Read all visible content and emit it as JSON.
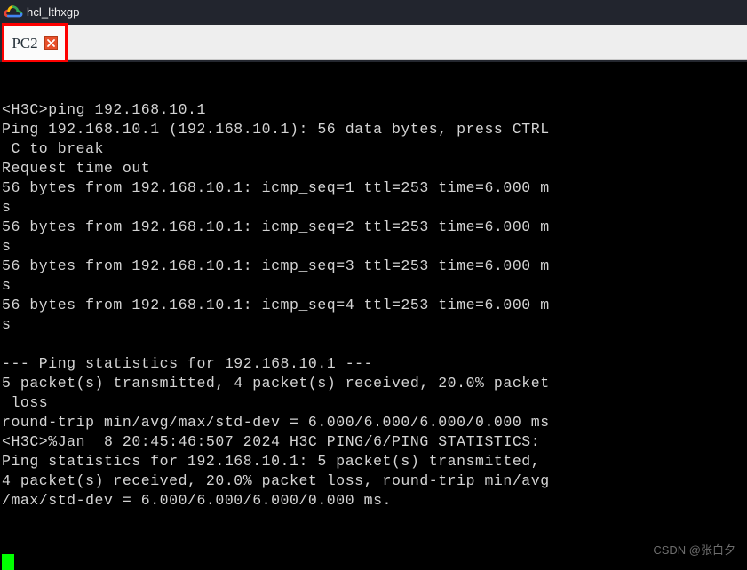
{
  "window": {
    "title": "hcl_lthxgp",
    "cloud_icon": "cloud-icon",
    "titlebar_color": "#22252e"
  },
  "tabs": [
    {
      "label": "PC2",
      "close_icon": "close-icon",
      "active": true,
      "highlight_color": "#fe0000"
    }
  ],
  "terminal": {
    "background": "#000000",
    "foreground": "#d4d4d4",
    "cursor_color": "#00ff00",
    "lines": [
      "",
      "<H3C>ping 192.168.10.1",
      "Ping 192.168.10.1 (192.168.10.1): 56 data bytes, press CTRL",
      "_C to break",
      "Request time out",
      "56 bytes from 192.168.10.1: icmp_seq=1 ttl=253 time=6.000 m",
      "s",
      "56 bytes from 192.168.10.1: icmp_seq=2 ttl=253 time=6.000 m",
      "s",
      "56 bytes from 192.168.10.1: icmp_seq=3 ttl=253 time=6.000 m",
      "s",
      "56 bytes from 192.168.10.1: icmp_seq=4 ttl=253 time=6.000 m",
      "s",
      "",
      "--- Ping statistics for 192.168.10.1 ---",
      "5 packet(s) transmitted, 4 packet(s) received, 20.0% packet",
      " loss",
      "round-trip min/avg/max/std-dev = 6.000/6.000/6.000/0.000 ms",
      "<H3C>%Jan  8 20:45:46:507 2024 H3C PING/6/PING_STATISTICS:",
      "Ping statistics for 192.168.10.1: 5 packet(s) transmitted,",
      "4 packet(s) received, 20.0% packet loss, round-trip min/avg",
      "/max/std-dev = 6.000/6.000/6.000/0.000 ms."
    ]
  },
  "watermark": {
    "text": "CSDN @张白夕"
  }
}
